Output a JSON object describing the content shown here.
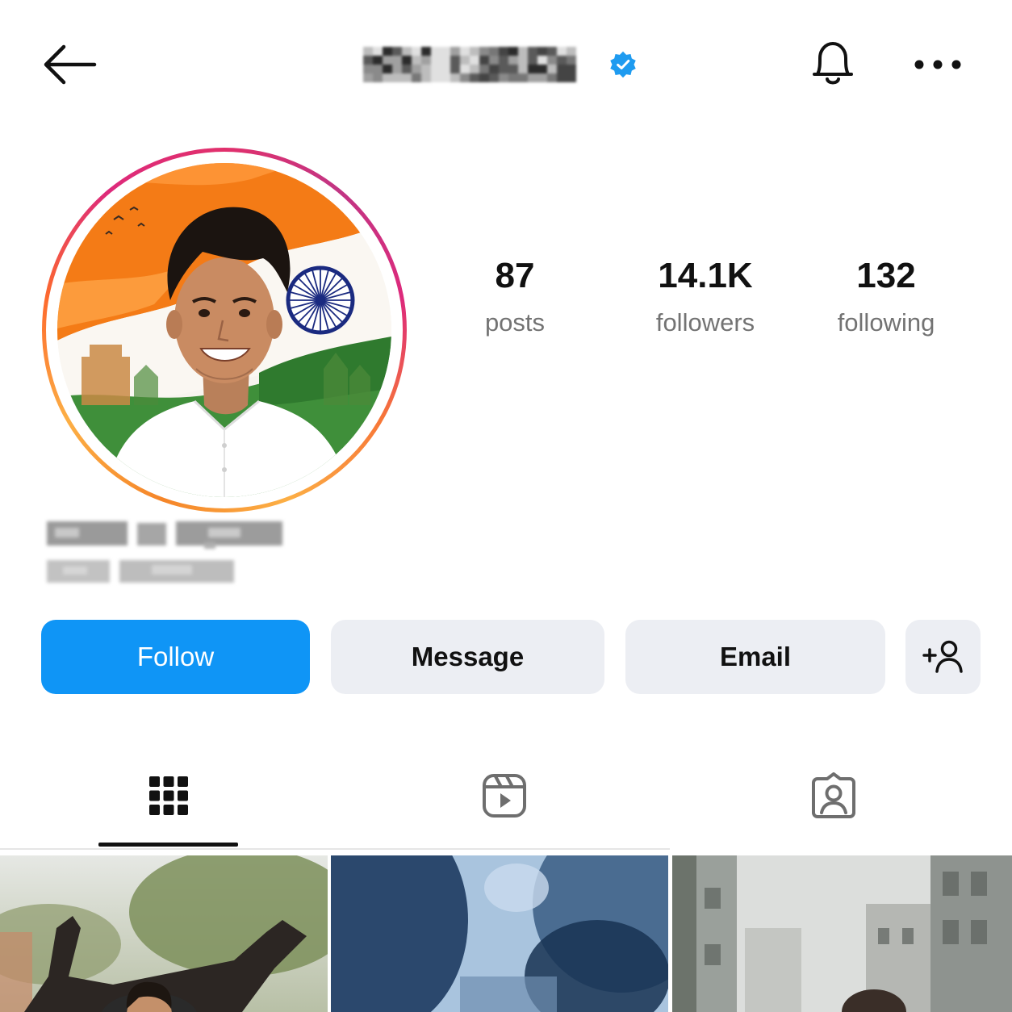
{
  "header": {
    "back_icon": "arrow-left-icon",
    "username": "[pixelated username]",
    "verified_badge_icon": "verified-badge-icon",
    "notification_icon": "bell-icon",
    "more_icon": "more-horizontal-icon"
  },
  "profile": {
    "avatar_description": "profile photo with story ring",
    "display_name": "[blurred name]",
    "category": "[blurred category]"
  },
  "stats": [
    {
      "value": "87",
      "label": "posts"
    },
    {
      "value": "14.1K",
      "label": "followers"
    },
    {
      "value": "132",
      "label": "following"
    }
  ],
  "actions": {
    "follow_label": "Follow",
    "message_label": "Message",
    "email_label": "Email",
    "add_user_icon": "add-person-icon"
  },
  "tabs": [
    {
      "icon": "grid-icon",
      "active": true
    },
    {
      "icon": "reels-icon",
      "active": false
    },
    {
      "icon": "tagged-icon",
      "active": false
    }
  ],
  "colors": {
    "accent_blue": "#0f95f6",
    "verified_blue": "#1e9bf0",
    "button_gray": "#eceef3",
    "secondary_text": "#737373"
  }
}
